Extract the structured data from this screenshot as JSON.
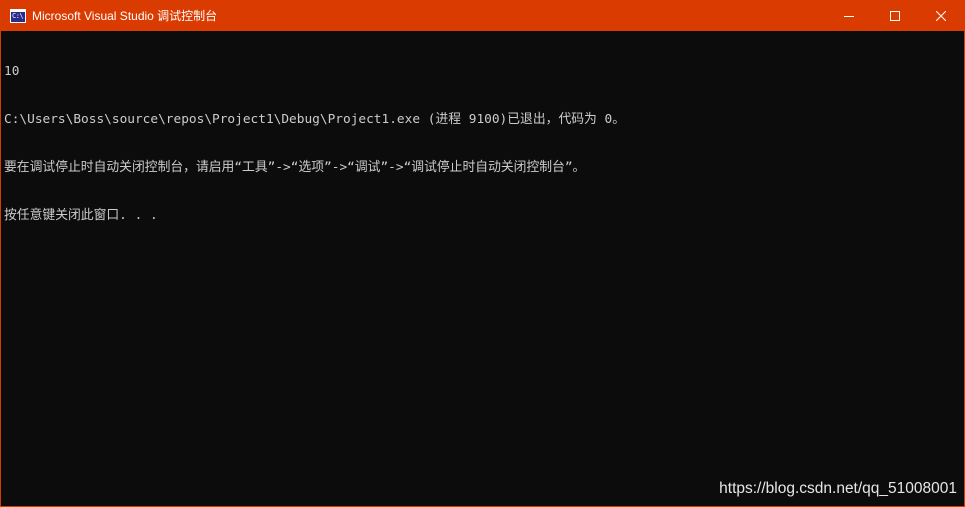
{
  "window": {
    "title": "Microsoft Visual Studio 调试控制台",
    "icon": "console-app-icon",
    "icon_text": "C:\\",
    "controls": {
      "minimize": "minimize-icon",
      "maximize": "maximize-icon",
      "close": "close-icon"
    }
  },
  "console": {
    "lines": [
      "10",
      "C:\\Users\\Boss\\source\\repos\\Project1\\Debug\\Project1.exe (进程 9100)已退出，代码为 0。",
      "要在调试停止时自动关闭控制台，请启用“工具”->“选项”->“调试”->“调试停止时自动关闭控制台”。",
      "按任意键关闭此窗口. . ."
    ]
  },
  "watermark": {
    "text": "https://blog.csdn.net/qq_51008001"
  },
  "colors": {
    "titlebar": "#da3b01",
    "console_bg": "#0c0c0c",
    "console_text": "#cccccc"
  }
}
